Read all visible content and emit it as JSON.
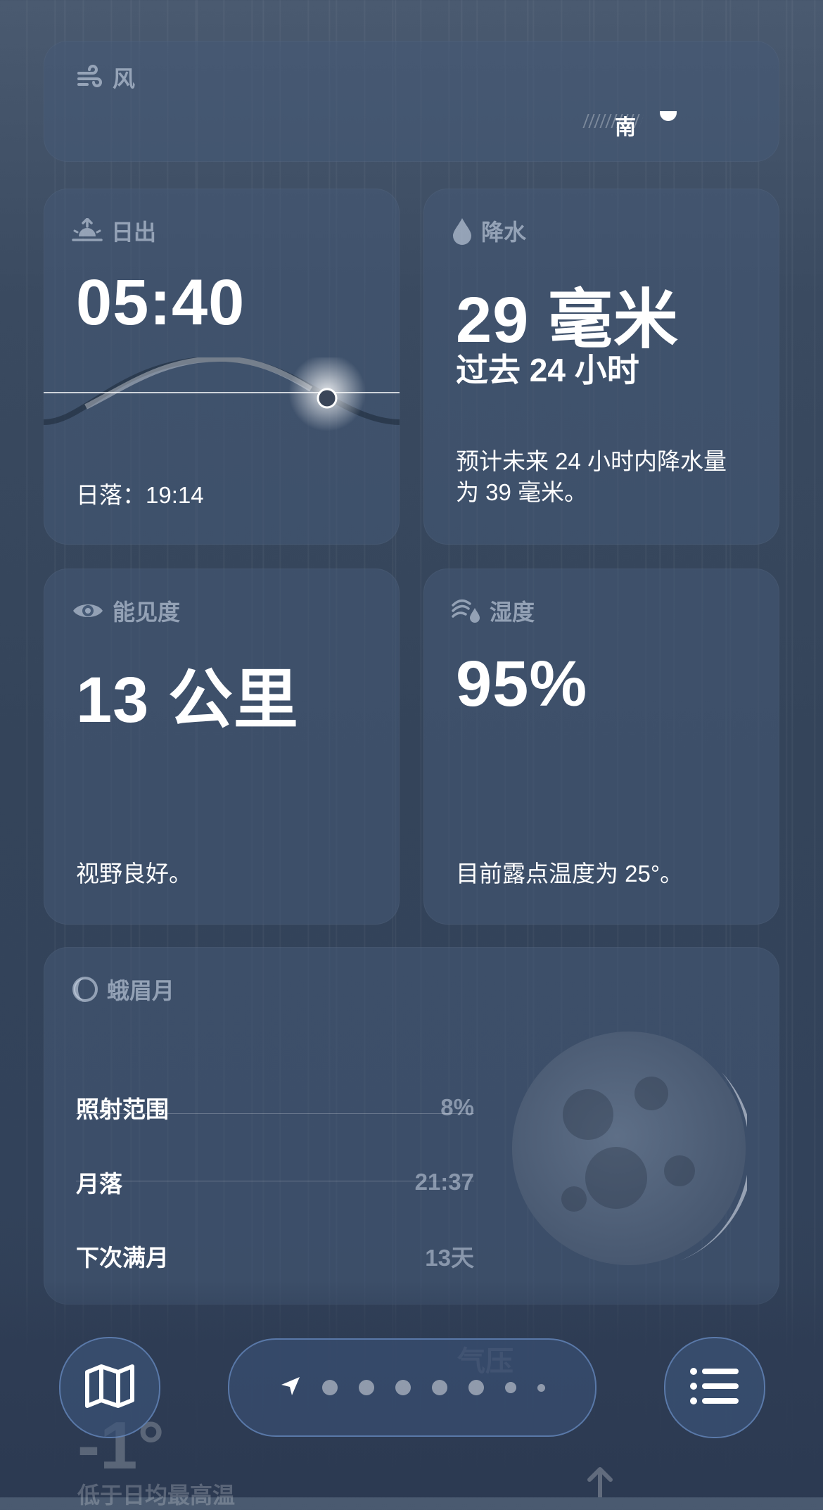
{
  "wind": {
    "title": "风",
    "compass_label": "南"
  },
  "sunrise": {
    "title": "日出",
    "time": "05:40",
    "sunset_label": "日落：",
    "sunset_time": "19:14"
  },
  "precipitation": {
    "title": "降水",
    "amount": "29 毫米",
    "period": "过去 24 小时",
    "forecast_line1": "预计未来 24 小时内降水量",
    "forecast_line2": "为 39 毫米。"
  },
  "visibility": {
    "title": "能见度",
    "value": "13 公里",
    "description": "视野良好。"
  },
  "humidity": {
    "title": "湿度",
    "value": "95%",
    "description": "目前露点温度为 25°。"
  },
  "moon": {
    "title": "蛾眉月",
    "rows": [
      {
        "label": "照射范围",
        "value": "8%"
      },
      {
        "label": "月落",
        "value": "21:37"
      },
      {
        "label": "下次满月",
        "value": "13天"
      }
    ]
  },
  "behind_cards": {
    "feels_like_value": "-1°",
    "feels_like_note": "低于日均最高温",
    "pressure_title": "气压"
  },
  "colors": {
    "background": "#3a4a60",
    "card": "#465a76",
    "accent_border": "#78a0dc"
  },
  "toolbar": {
    "map_icon": "map-icon",
    "list_icon": "list-icon",
    "location_icon": "location-arrow-icon",
    "page_count": 7
  }
}
